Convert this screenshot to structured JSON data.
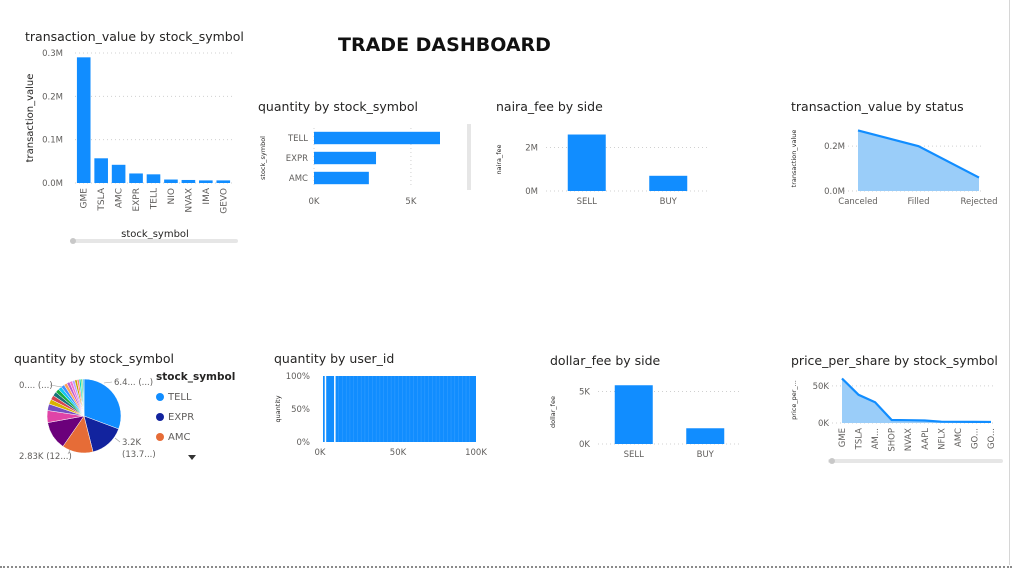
{
  "dashboard": {
    "title": "TRADE DASHBOARD"
  },
  "colors": {
    "primary": "#118DFF",
    "area_fill": "#9ACDF9",
    "grid": "#d0d0d0",
    "axis_text": "#605e5c"
  },
  "chart_data": [
    {
      "id": "c1",
      "type": "bar",
      "title": "transaction_value by stock_symbol",
      "xlabel": "stock_symbol",
      "ylabel": "transaction_value",
      "categories": [
        "GME",
        "TSLA",
        "AMC",
        "EXPR",
        "TELL",
        "NIO",
        "NVAX",
        "IMA",
        "GEVO"
      ],
      "values": [
        0.29,
        0.057,
        0.042,
        0.022,
        0.02,
        0.008,
        0.007,
        0.006,
        0.006
      ],
      "ylim": [
        0,
        0.3
      ],
      "yticks": [
        0,
        0.1,
        0.2,
        0.3
      ],
      "ytick_labels": [
        "0.0M",
        "0.1M",
        "0.2M",
        "0.3M"
      ],
      "grid": true
    },
    {
      "id": "c2",
      "type": "bar",
      "orientation": "horizontal",
      "title": "quantity by stock_symbol",
      "ylabel": "stock_symbol",
      "categories": [
        "TELL",
        "EXPR",
        "AMC"
      ],
      "values": [
        6500,
        3200,
        2830
      ],
      "xlim": [
        0,
        6500
      ],
      "xticks": [
        0,
        5000
      ],
      "xtick_labels": [
        "0K",
        "5K"
      ],
      "grid": true
    },
    {
      "id": "c3",
      "type": "bar",
      "title": "naira_fee by side",
      "ylabel": "naira_fee",
      "categories": [
        "SELL",
        "BUY"
      ],
      "values": [
        2.6,
        0.7
      ],
      "ylim": [
        0,
        2.9
      ],
      "yticks": [
        0,
        2
      ],
      "ytick_labels": [
        "0M",
        "2M"
      ],
      "grid": true
    },
    {
      "id": "c4",
      "type": "area",
      "title": "transaction_value by status",
      "ylabel": "transaction_value",
      "categories": [
        "Canceled",
        "Filled",
        "Rejected"
      ],
      "values": [
        0.27,
        0.2,
        0.06
      ],
      "ylim": [
        0,
        0.29
      ],
      "yticks": [
        0,
        0.2
      ],
      "ytick_labels": [
        "0.0M",
        "0.2M"
      ],
      "grid": true
    },
    {
      "id": "c5",
      "type": "pie",
      "title": "quantity by stock_symbol",
      "legend_title": "stock_symbol",
      "slices": [
        {
          "label": "TELL",
          "value": 6400,
          "color": "#118DFF"
        },
        {
          "label": "EXPR",
          "value": 3200,
          "color": "#12239E"
        },
        {
          "label": "AMC",
          "value": 2830,
          "color": "#E66C37"
        },
        {
          "label": "",
          "value": 2600,
          "color": "#6B007B"
        },
        {
          "label": "",
          "value": 1100,
          "color": "#E044A7"
        },
        {
          "label": "",
          "value": 600,
          "color": "#744EC2"
        },
        {
          "label": "",
          "value": 450,
          "color": "#D9B300"
        },
        {
          "label": "",
          "value": 400,
          "color": "#D64550"
        },
        {
          "label": "",
          "value": 380,
          "color": "#197278"
        },
        {
          "label": "",
          "value": 350,
          "color": "#1AAB40"
        },
        {
          "label": "",
          "value": 330,
          "color": "#15C6F4"
        },
        {
          "label": "",
          "value": 310,
          "color": "#4092FF"
        },
        {
          "label": "",
          "value": 290,
          "color": "#FFA058"
        },
        {
          "label": "",
          "value": 270,
          "color": "#BE5DC9"
        },
        {
          "label": "",
          "value": 250,
          "color": "#F472D0"
        },
        {
          "label": "",
          "value": 230,
          "color": "#B5A1FF"
        },
        {
          "label": "",
          "value": 210,
          "color": "#C4A200"
        },
        {
          "label": "",
          "value": 190,
          "color": "#FF8080"
        },
        {
          "label": "",
          "value": 170,
          "color": "#00DBBC"
        },
        {
          "label": "",
          "value": 150,
          "color": "#5BD667"
        },
        {
          "label": "",
          "value": 130,
          "color": "#48C0FB"
        }
      ],
      "legend": [
        "TELL",
        "EXPR",
        "AMC"
      ],
      "data_labels": {
        "top_right": "6.4... (...)",
        "right_1": "3.2K",
        "right_2": "(13.7...)",
        "bottom_left": "2.83K (12...)",
        "top_left": "0.... (...)"
      }
    },
    {
      "id": "c6",
      "type": "bar",
      "title": "quantity by user_id",
      "ylabel": "quantity",
      "xlim": [
        0,
        100000
      ],
      "xticks": [
        0,
        50000,
        100000
      ],
      "xtick_labels": [
        "0K",
        "50K",
        "100K"
      ],
      "yticks": [
        0,
        0.5,
        1
      ],
      "ytick_labels": [
        "0%",
        "50%",
        "100%"
      ],
      "note_values": "dense 100% stacked bars spanning user_id 0K–100K",
      "gaps": [
        3500,
        9500
      ]
    },
    {
      "id": "c7",
      "type": "bar",
      "title": "dollar_fee by side",
      "ylabel": "dollar_fee",
      "categories": [
        "SELL",
        "BUY"
      ],
      "values": [
        5600,
        1500
      ],
      "ylim": [
        0,
        6100
      ],
      "yticks": [
        0,
        5000
      ],
      "ytick_labels": [
        "0K",
        "5K"
      ],
      "grid": true
    },
    {
      "id": "c8",
      "type": "area",
      "title": "price_per_share by stock_symbol",
      "ylabel": "price_per_...",
      "categories": [
        "GME",
        "TSLA",
        "AM...",
        "SHOP",
        "NVAX",
        "AAPL",
        "NFLX",
        "AMC",
        "GO...",
        "GO..."
      ],
      "values": [
        60000,
        38000,
        28000,
        4000,
        3800,
        3400,
        1800,
        1600,
        1500,
        1400
      ],
      "ylim": [
        0,
        62000
      ],
      "yticks": [
        0,
        50000
      ],
      "ytick_labels": [
        "0K",
        "50K"
      ],
      "grid": true
    }
  ]
}
